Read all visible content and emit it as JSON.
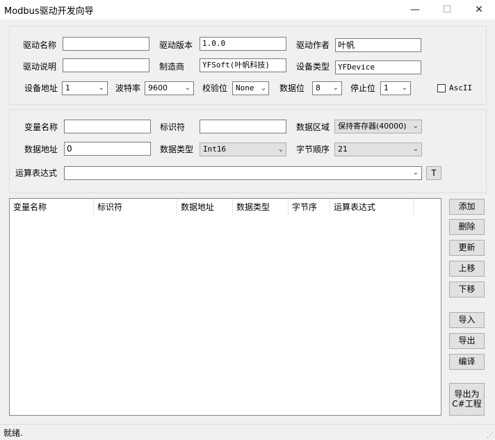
{
  "window": {
    "title": "Modbus驱动开发向导",
    "minimize": "—",
    "maximize": "☐",
    "close": "✕"
  },
  "driver": {
    "name_label": "驱动名称",
    "name_value": "",
    "version_label": "驱动版本",
    "version_value": "1.0.0",
    "author_label": "驱动作者",
    "author_value": "叶帆",
    "desc_label": "驱动说明",
    "desc_value": "",
    "maker_label": "制造商",
    "maker_value": "YFSoft(叶帆科技)",
    "devtype_label": "设备类型",
    "devtype_value": "YFDevice",
    "addr_label": "设备地址",
    "addr_value": "1",
    "baud_label": "波特率",
    "baud_value": "9600",
    "parity_label": "校验位",
    "parity_value": "None",
    "databits_label": "数据位",
    "databits_value": "8",
    "stopbits_label": "停止位",
    "stopbits_value": "1",
    "ascii_label": "AscII"
  },
  "variable": {
    "name_label": "变量名称",
    "name_value": "",
    "id_label": "标识符",
    "id_value": "",
    "area_label": "数据区域",
    "area_value": "保持寄存器(40000)",
    "addr_label": "数据地址",
    "addr_value": "0",
    "type_label": "数据类型",
    "type_value": "Int16",
    "order_label": "字节顺序",
    "order_value": "21",
    "expr_label": "运算表达式",
    "expr_value": "",
    "t_button": "T"
  },
  "table": {
    "columns": [
      "变量名称",
      "标识符",
      "数据地址",
      "数据类型",
      "字节序",
      "运算表达式"
    ]
  },
  "buttons": {
    "add": "添加",
    "delete": "删除",
    "update": "更新",
    "up": "上移",
    "down": "下移",
    "import": "导入",
    "export": "导出",
    "compile": "编译",
    "export_cs_line1": "导出为",
    "export_cs_line2": "C#工程"
  },
  "status": "就绪."
}
